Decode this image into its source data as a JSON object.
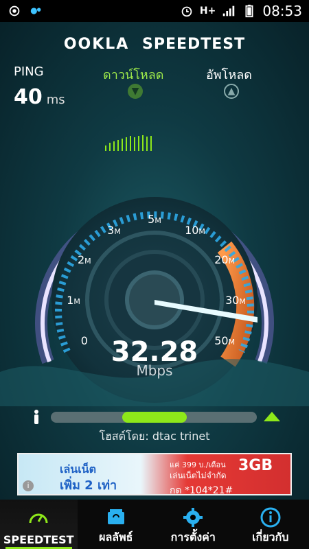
{
  "status_bar": {
    "time": "08:53",
    "network": "H+"
  },
  "app": {
    "brand_left": "OOKLA",
    "brand_right": "SPEEDTEST"
  },
  "metrics": {
    "ping_label": "PING",
    "ping_value": "40",
    "ping_unit": "ms",
    "download_label": "ดาวน์โหลด",
    "upload_label": "อัพโหลด"
  },
  "gauge": {
    "ticks": [
      {
        "label": "0",
        "unit": ""
      },
      {
        "label": "1",
        "unit": "M"
      },
      {
        "label": "2",
        "unit": "M"
      },
      {
        "label": "3",
        "unit": "M"
      },
      {
        "label": "5",
        "unit": "M"
      },
      {
        "label": "10",
        "unit": "M"
      },
      {
        "label": "20",
        "unit": "M"
      },
      {
        "label": "30",
        "unit": "M"
      },
      {
        "label": "50",
        "unit": "M"
      }
    ],
    "speed": "32.28",
    "unit": "Mbps",
    "accent": "#ff8c3a",
    "ring": "#c7b7ff"
  },
  "progress": {
    "fraction": 0.66,
    "host_text": "โฮสต์โดย: dtac trinet"
  },
  "ad": {
    "line1": "เล่นเน็ต",
    "line2": "เพิ่ม 2 เท่า",
    "line3": "แค่ 399 บ./เดือน",
    "line4": "เล่นเน็ตไม่จำกัด",
    "line5": "กด *104*21#",
    "line6": "3GB"
  },
  "nav": [
    {
      "label": "SPEEDTEST",
      "icon": "speedometer-icon",
      "active": true
    },
    {
      "label": "ผลลัพธ์",
      "icon": "results-icon",
      "active": false
    },
    {
      "label": "การตั้งค่า",
      "icon": "gear-icon",
      "active": false
    },
    {
      "label": "เกี่ยวกับ",
      "icon": "info-icon",
      "active": false
    }
  ]
}
